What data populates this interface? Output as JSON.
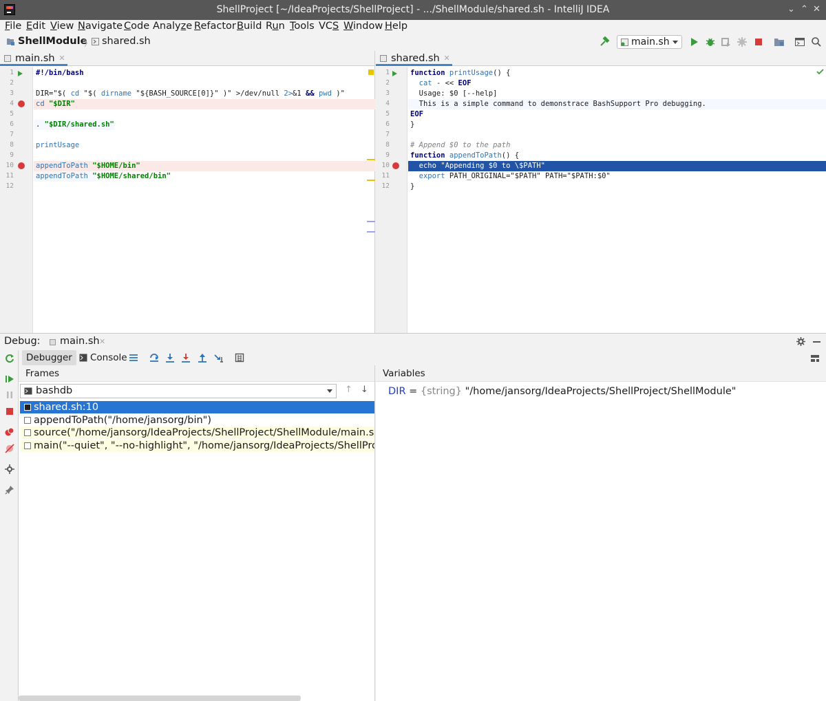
{
  "window": {
    "title": "ShellProject [~/IdeaProjects/ShellProject] - .../ShellModule/shared.sh - IntelliJ IDEA",
    "controls": [
      "⌄",
      "⌃",
      "✕"
    ]
  },
  "menu": [
    "File",
    "Edit",
    "View",
    "Navigate",
    "Code",
    "Analyze",
    "Refactor",
    "Build",
    "Run",
    "Tools",
    "VCS",
    "Window",
    "Help"
  ],
  "menu_mnemonics": [
    "F",
    "E",
    "V",
    "N",
    "C",
    "z",
    "R",
    "B",
    "u",
    "T",
    "S",
    "W",
    "H"
  ],
  "breadcrumb": {
    "module": "ShellModule",
    "file": "shared.sh"
  },
  "toolbar": {
    "run_config": "main.sh"
  },
  "editor_left": {
    "tab": "main.sh",
    "line_numbers": [
      "1",
      "2",
      "3",
      "4",
      "5",
      "6",
      "7",
      "8",
      "9",
      "10",
      "11",
      "12"
    ],
    "lines": [
      [
        {
          "t": "#!/bin/bash",
          "c": "k"
        }
      ],
      [],
      [
        {
          "t": "DIR=\"$( ",
          "c": ""
        },
        {
          "t": "cd ",
          "c": "fn"
        },
        {
          "t": "\"$( ",
          "c": ""
        },
        {
          "t": "dirname ",
          "c": "fn"
        },
        {
          "t": "\"${BASH_SOURCE[0]}\"",
          "c": ""
        },
        {
          "t": " )\" ",
          "c": ""
        },
        {
          "t": ">/dev/null ",
          "c": ""
        },
        {
          "t": "2>",
          "c": "fn"
        },
        {
          "t": "&1 ",
          "c": ""
        },
        {
          "t": "&& ",
          "c": "k"
        },
        {
          "t": "pwd ",
          "c": "fn"
        },
        {
          "t": ")\"",
          "c": ""
        }
      ],
      [
        {
          "t": "cd ",
          "c": "fn"
        },
        {
          "t": "\"$DIR\"",
          "c": "s"
        }
      ],
      [],
      [
        {
          "t": ". ",
          "c": ""
        },
        {
          "t": "\"$DIR/shared.sh\"",
          "c": "s"
        }
      ],
      [],
      [
        {
          "t": "printUsage",
          "c": "fn"
        }
      ],
      [],
      [
        {
          "t": "appendToPath ",
          "c": "fn"
        },
        {
          "t": "\"$HOME/bin\"",
          "c": "s"
        }
      ],
      [
        {
          "t": "appendToPath ",
          "c": "fn"
        },
        {
          "t": "\"$HOME/shared/bin\"",
          "c": "s"
        }
      ],
      []
    ]
  },
  "editor_right": {
    "tab": "shared.sh",
    "line_numbers": [
      "1",
      "2",
      "3",
      "4",
      "5",
      "6",
      "7",
      "8",
      "9",
      "10",
      "11",
      "12"
    ],
    "lines": [
      [
        {
          "t": "function ",
          "c": "k"
        },
        {
          "t": "printUsage",
          "c": "fn"
        },
        {
          "t": "() {",
          "c": ""
        }
      ],
      [
        {
          "t": "  cat ",
          "c": "fn"
        },
        {
          "t": "- << ",
          "c": ""
        },
        {
          "t": "EOF",
          "c": "k"
        }
      ],
      [
        {
          "t": "  Usage: $0 [--help]",
          "c": ""
        }
      ],
      [
        {
          "t": "  This is a simple command to demonstrace BashSupport Pro debugging.",
          "c": ""
        }
      ],
      [
        {
          "t": "EOF",
          "c": "k"
        }
      ],
      [
        {
          "t": "}",
          "c": ""
        }
      ],
      [],
      [
        {
          "t": "# Append $0 to the path",
          "c": "c"
        }
      ],
      [
        {
          "t": "function ",
          "c": "k"
        },
        {
          "t": "appendToPath",
          "c": "fn"
        },
        {
          "t": "() {",
          "c": ""
        }
      ],
      [
        {
          "t": "  echo ",
          "c": ""
        },
        {
          "t": "\"Appending $0 to \\$PATH\"",
          "c": ""
        }
      ],
      [
        {
          "t": "  export ",
          "c": "fn"
        },
        {
          "t": "PATH_ORIGINAL=\"$PATH\" PATH=\"$PATH:$0\"",
          "c": ""
        }
      ],
      [
        {
          "t": "}",
          "c": ""
        }
      ]
    ]
  },
  "debug": {
    "label": "Debug:",
    "session_tab": "main.sh",
    "tabs": {
      "debugger": "Debugger",
      "console": "Console"
    },
    "frames_title": "Frames",
    "thread": "bashdb",
    "frames": [
      "shared.sh:10",
      "appendToPath(\"/home/jansorg/bin\")",
      "source(\"/home/jansorg/IdeaProjects/ShellProject/ShellModule/main.sh\")",
      "main(\"--quiet\", \"--no-highlight\", \"/home/jansorg/IdeaProjects/ShellProject/Sh"
    ],
    "variables_title": "Variables",
    "variable": {
      "name": "DIR",
      "eq": " = ",
      "type": "{string}",
      "value": " \"/home/jansorg/IdeaProjects/ShellProject/ShellModule\""
    }
  },
  "colors": {
    "accent": "#2675d2",
    "exec_line": "#2154a6",
    "breakpoint": "#d83a3a",
    "run": "#3a9b3a"
  }
}
